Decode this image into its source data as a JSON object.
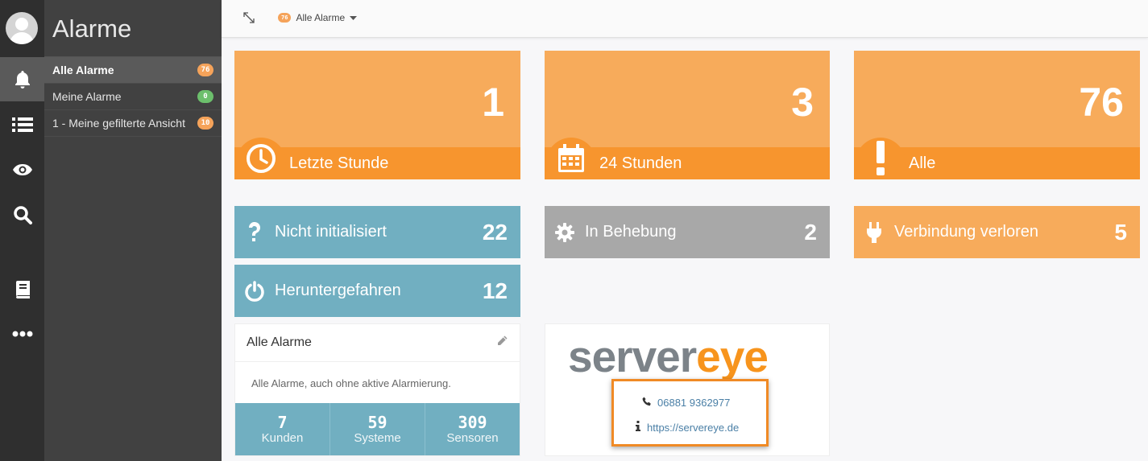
{
  "sidebar": {
    "title": "Alarme",
    "items": [
      {
        "label": "Alle Alarme",
        "count": "76",
        "color": "#f5a35a"
      },
      {
        "label": "Meine Alarme",
        "count": "0",
        "color": "#6cbf6c"
      },
      {
        "label": "1 - Meine gefilterte Ansicht",
        "count": "10",
        "color": "#f5a35a"
      }
    ]
  },
  "rail": {
    "icons": [
      "bell-icon",
      "list-icon",
      "eye-icon",
      "search-icon",
      "book-icon",
      "more-icon"
    ]
  },
  "topbar": {
    "filter_badge": "76",
    "filter_label": "Alle Alarme"
  },
  "tiles": {
    "last_hour": {
      "value": "1",
      "label": "Letzte Stunde",
      "icon": "clock-icon"
    },
    "day": {
      "value": "3",
      "label": "24 Stunden",
      "icon": "calendar-icon"
    },
    "all": {
      "value": "76",
      "label": "Alle",
      "icon": "exclamation-icon"
    }
  },
  "status": {
    "not_initialized": {
      "label": "Nicht initialisiert",
      "value": "22",
      "icon": "question-icon"
    },
    "in_repair": {
      "label": "In Behebung",
      "value": "2",
      "icon": "gear-icon"
    },
    "connection_lost": {
      "label": "Verbindung verloren",
      "value": "5",
      "icon": "plug-icon"
    },
    "shutdown": {
      "label": "Heruntergefahren",
      "value": "12",
      "icon": "power-icon"
    }
  },
  "panel": {
    "title": "Alle Alarme",
    "description": "Alle Alarme, auch ohne aktive Alarmierung.",
    "stats": [
      {
        "value": "7",
        "label": "Kunden"
      },
      {
        "value": "59",
        "label": "Systeme"
      },
      {
        "value": "309",
        "label": "Sensoren"
      }
    ]
  },
  "contact": {
    "logo_left": "server",
    "logo_right": "eye",
    "phone": "06881 9362977",
    "website": "https://servereye.de"
  },
  "colors": {
    "orange_light": "#f7ab5b",
    "orange_dark": "#f7952e",
    "teal": "#71afc1",
    "grey": "#a8a8a8",
    "rail": "#2f2f2f",
    "sidebar": "#414141"
  }
}
